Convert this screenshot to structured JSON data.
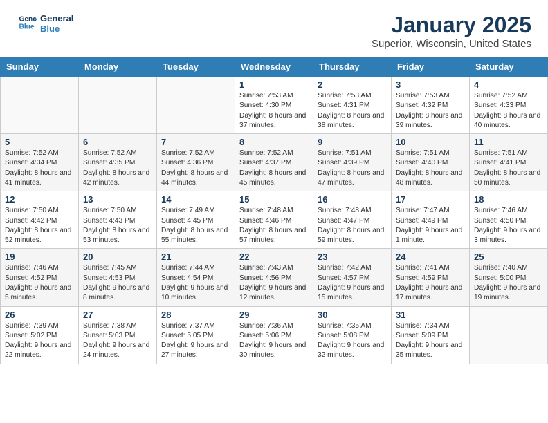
{
  "header": {
    "logo_line1": "General",
    "logo_line2": "Blue",
    "month": "January 2025",
    "location": "Superior, Wisconsin, United States"
  },
  "weekdays": [
    "Sunday",
    "Monday",
    "Tuesday",
    "Wednesday",
    "Thursday",
    "Friday",
    "Saturday"
  ],
  "weeks": [
    [
      {
        "day": "",
        "info": ""
      },
      {
        "day": "",
        "info": ""
      },
      {
        "day": "",
        "info": ""
      },
      {
        "day": "1",
        "info": "Sunrise: 7:53 AM\nSunset: 4:30 PM\nDaylight: 8 hours and 37 minutes."
      },
      {
        "day": "2",
        "info": "Sunrise: 7:53 AM\nSunset: 4:31 PM\nDaylight: 8 hours and 38 minutes."
      },
      {
        "day": "3",
        "info": "Sunrise: 7:53 AM\nSunset: 4:32 PM\nDaylight: 8 hours and 39 minutes."
      },
      {
        "day": "4",
        "info": "Sunrise: 7:52 AM\nSunset: 4:33 PM\nDaylight: 8 hours and 40 minutes."
      }
    ],
    [
      {
        "day": "5",
        "info": "Sunrise: 7:52 AM\nSunset: 4:34 PM\nDaylight: 8 hours and 41 minutes."
      },
      {
        "day": "6",
        "info": "Sunrise: 7:52 AM\nSunset: 4:35 PM\nDaylight: 8 hours and 42 minutes."
      },
      {
        "day": "7",
        "info": "Sunrise: 7:52 AM\nSunset: 4:36 PM\nDaylight: 8 hours and 44 minutes."
      },
      {
        "day": "8",
        "info": "Sunrise: 7:52 AM\nSunset: 4:37 PM\nDaylight: 8 hours and 45 minutes."
      },
      {
        "day": "9",
        "info": "Sunrise: 7:51 AM\nSunset: 4:39 PM\nDaylight: 8 hours and 47 minutes."
      },
      {
        "day": "10",
        "info": "Sunrise: 7:51 AM\nSunset: 4:40 PM\nDaylight: 8 hours and 48 minutes."
      },
      {
        "day": "11",
        "info": "Sunrise: 7:51 AM\nSunset: 4:41 PM\nDaylight: 8 hours and 50 minutes."
      }
    ],
    [
      {
        "day": "12",
        "info": "Sunrise: 7:50 AM\nSunset: 4:42 PM\nDaylight: 8 hours and 52 minutes."
      },
      {
        "day": "13",
        "info": "Sunrise: 7:50 AM\nSunset: 4:43 PM\nDaylight: 8 hours and 53 minutes."
      },
      {
        "day": "14",
        "info": "Sunrise: 7:49 AM\nSunset: 4:45 PM\nDaylight: 8 hours and 55 minutes."
      },
      {
        "day": "15",
        "info": "Sunrise: 7:48 AM\nSunset: 4:46 PM\nDaylight: 8 hours and 57 minutes."
      },
      {
        "day": "16",
        "info": "Sunrise: 7:48 AM\nSunset: 4:47 PM\nDaylight: 8 hours and 59 minutes."
      },
      {
        "day": "17",
        "info": "Sunrise: 7:47 AM\nSunset: 4:49 PM\nDaylight: 9 hours and 1 minute."
      },
      {
        "day": "18",
        "info": "Sunrise: 7:46 AM\nSunset: 4:50 PM\nDaylight: 9 hours and 3 minutes."
      }
    ],
    [
      {
        "day": "19",
        "info": "Sunrise: 7:46 AM\nSunset: 4:52 PM\nDaylight: 9 hours and 5 minutes."
      },
      {
        "day": "20",
        "info": "Sunrise: 7:45 AM\nSunset: 4:53 PM\nDaylight: 9 hours and 8 minutes."
      },
      {
        "day": "21",
        "info": "Sunrise: 7:44 AM\nSunset: 4:54 PM\nDaylight: 9 hours and 10 minutes."
      },
      {
        "day": "22",
        "info": "Sunrise: 7:43 AM\nSunset: 4:56 PM\nDaylight: 9 hours and 12 minutes."
      },
      {
        "day": "23",
        "info": "Sunrise: 7:42 AM\nSunset: 4:57 PM\nDaylight: 9 hours and 15 minutes."
      },
      {
        "day": "24",
        "info": "Sunrise: 7:41 AM\nSunset: 4:59 PM\nDaylight: 9 hours and 17 minutes."
      },
      {
        "day": "25",
        "info": "Sunrise: 7:40 AM\nSunset: 5:00 PM\nDaylight: 9 hours and 19 minutes."
      }
    ],
    [
      {
        "day": "26",
        "info": "Sunrise: 7:39 AM\nSunset: 5:02 PM\nDaylight: 9 hours and 22 minutes."
      },
      {
        "day": "27",
        "info": "Sunrise: 7:38 AM\nSunset: 5:03 PM\nDaylight: 9 hours and 24 minutes."
      },
      {
        "day": "28",
        "info": "Sunrise: 7:37 AM\nSunset: 5:05 PM\nDaylight: 9 hours and 27 minutes."
      },
      {
        "day": "29",
        "info": "Sunrise: 7:36 AM\nSunset: 5:06 PM\nDaylight: 9 hours and 30 minutes."
      },
      {
        "day": "30",
        "info": "Sunrise: 7:35 AM\nSunset: 5:08 PM\nDaylight: 9 hours and 32 minutes."
      },
      {
        "day": "31",
        "info": "Sunrise: 7:34 AM\nSunset: 5:09 PM\nDaylight: 9 hours and 35 minutes."
      },
      {
        "day": "",
        "info": ""
      }
    ]
  ]
}
